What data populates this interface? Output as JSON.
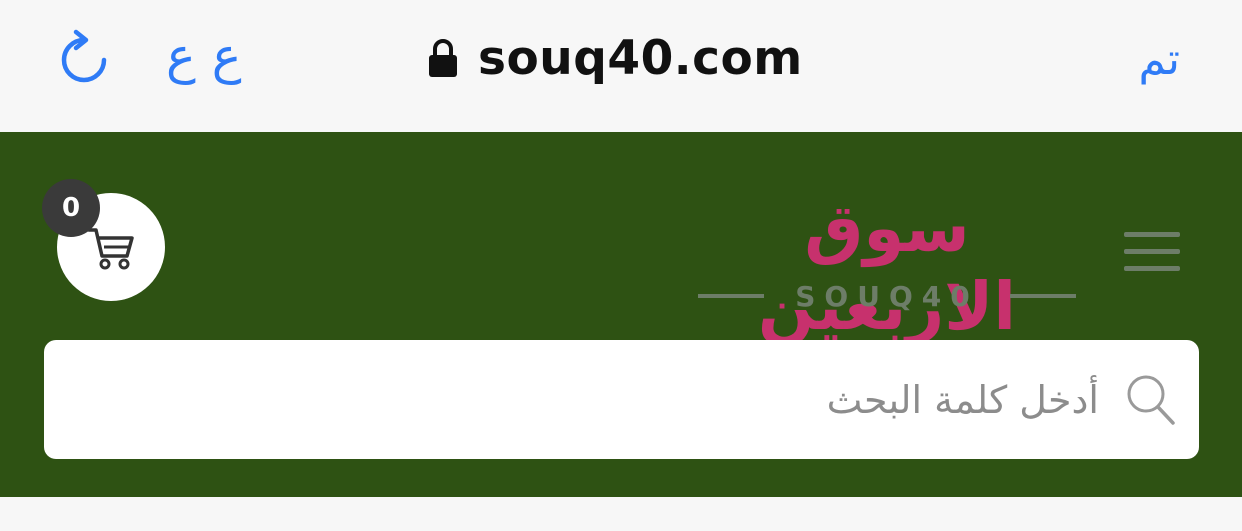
{
  "browser": {
    "url": "souq40.com",
    "text_size_label": "ع ع",
    "done_label": "تم",
    "accent": "#2f7bf6"
  },
  "header": {
    "background": "#2e5213",
    "cart_count": "0",
    "logo_arabic": "سوق الاربعين",
    "logo_latin": "SOUQ40",
    "search_placeholder": "أدخل كلمة البحث"
  },
  "icons": {
    "reload": "reload-icon",
    "lock": "lock-icon",
    "cart": "cart-icon",
    "menu": "hamburger-menu-icon",
    "search": "search-icon"
  }
}
